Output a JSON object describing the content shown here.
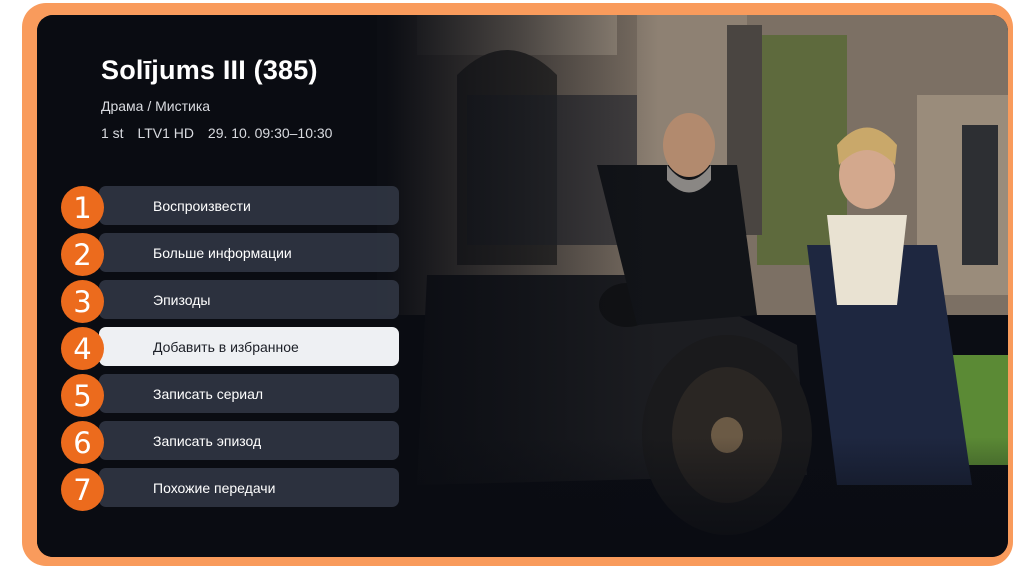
{
  "program": {
    "title": "Solījums III (385)",
    "genre": "Драма / Мистика",
    "channel_number": "1 st",
    "channel_name": "LTV1 HD",
    "schedule": "29. 10. 09:30–10:30"
  },
  "menu": {
    "items": [
      {
        "number": "1",
        "label": "Воспроизвести"
      },
      {
        "number": "2",
        "label": "Больше информации"
      },
      {
        "number": "3",
        "label": "Эпизоды"
      },
      {
        "number": "4",
        "label": "Добавить в избранное"
      },
      {
        "number": "5",
        "label": "Записать сериал"
      },
      {
        "number": "6",
        "label": "Записать эпизод"
      },
      {
        "number": "7",
        "label": "Похожие передачи"
      }
    ],
    "focused_index": 3
  },
  "colors": {
    "frame": "#f99b5c",
    "badge": "#ec6b1d",
    "focused_item": "#eef0f3",
    "item": "#303542"
  }
}
